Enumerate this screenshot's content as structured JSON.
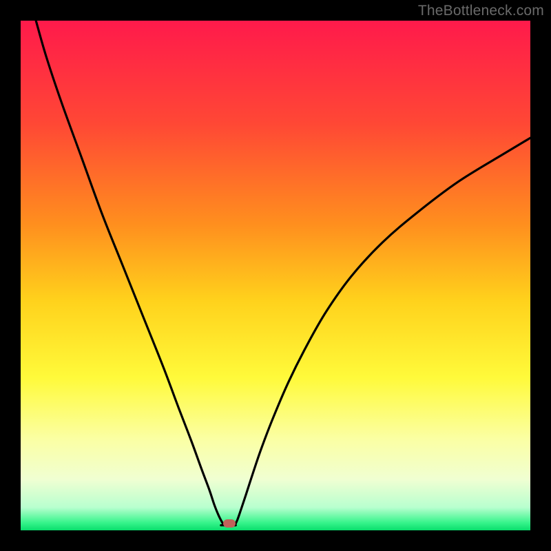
{
  "watermark": {
    "text": "TheBottleneck.com"
  },
  "chart_data": {
    "type": "line",
    "title": "",
    "xlabel": "",
    "ylabel": "",
    "xlim": [
      0,
      100
    ],
    "ylim": [
      0,
      100
    ],
    "gradient_stops": [
      {
        "pos": 0.0,
        "color": "#ff1a4b"
      },
      {
        "pos": 0.2,
        "color": "#ff4735"
      },
      {
        "pos": 0.4,
        "color": "#ff8f1e"
      },
      {
        "pos": 0.55,
        "color": "#ffd21c"
      },
      {
        "pos": 0.7,
        "color": "#fffa3a"
      },
      {
        "pos": 0.82,
        "color": "#fbffa3"
      },
      {
        "pos": 0.9,
        "color": "#f0ffd2"
      },
      {
        "pos": 0.955,
        "color": "#b8ffcf"
      },
      {
        "pos": 0.985,
        "color": "#37f48b"
      },
      {
        "pos": 1.0,
        "color": "#09de6c"
      }
    ],
    "series": [
      {
        "name": "bottleneck-curve-left",
        "x": [
          3,
          5,
          8,
          12,
          16,
          20,
          24,
          28,
          31,
          33.5,
          35.5,
          37,
          38,
          38.8,
          39.3,
          39.7,
          40
        ],
        "y": [
          100,
          93,
          84,
          73,
          62,
          52,
          42,
          32,
          24,
          17.5,
          12,
          8,
          5,
          3,
          2,
          1.3,
          1
        ]
      },
      {
        "name": "bottleneck-curve-right",
        "x": [
          42,
          42.5,
          43.2,
          44.2,
          45.5,
          47.2,
          49.5,
          52.5,
          56,
          60,
          65,
          71,
          78,
          86,
          95,
          100
        ],
        "y": [
          1,
          2,
          4,
          7,
          11,
          16,
          22,
          29,
          36,
          43,
          50,
          56.5,
          62.5,
          68.5,
          74,
          77
        ]
      },
      {
        "name": "bottleneck-floor",
        "x": [
          39.3,
          42.2
        ],
        "y": [
          1,
          1
        ]
      }
    ],
    "marker": {
      "x": 41,
      "y": 1.3,
      "color": "#c0625a"
    }
  }
}
